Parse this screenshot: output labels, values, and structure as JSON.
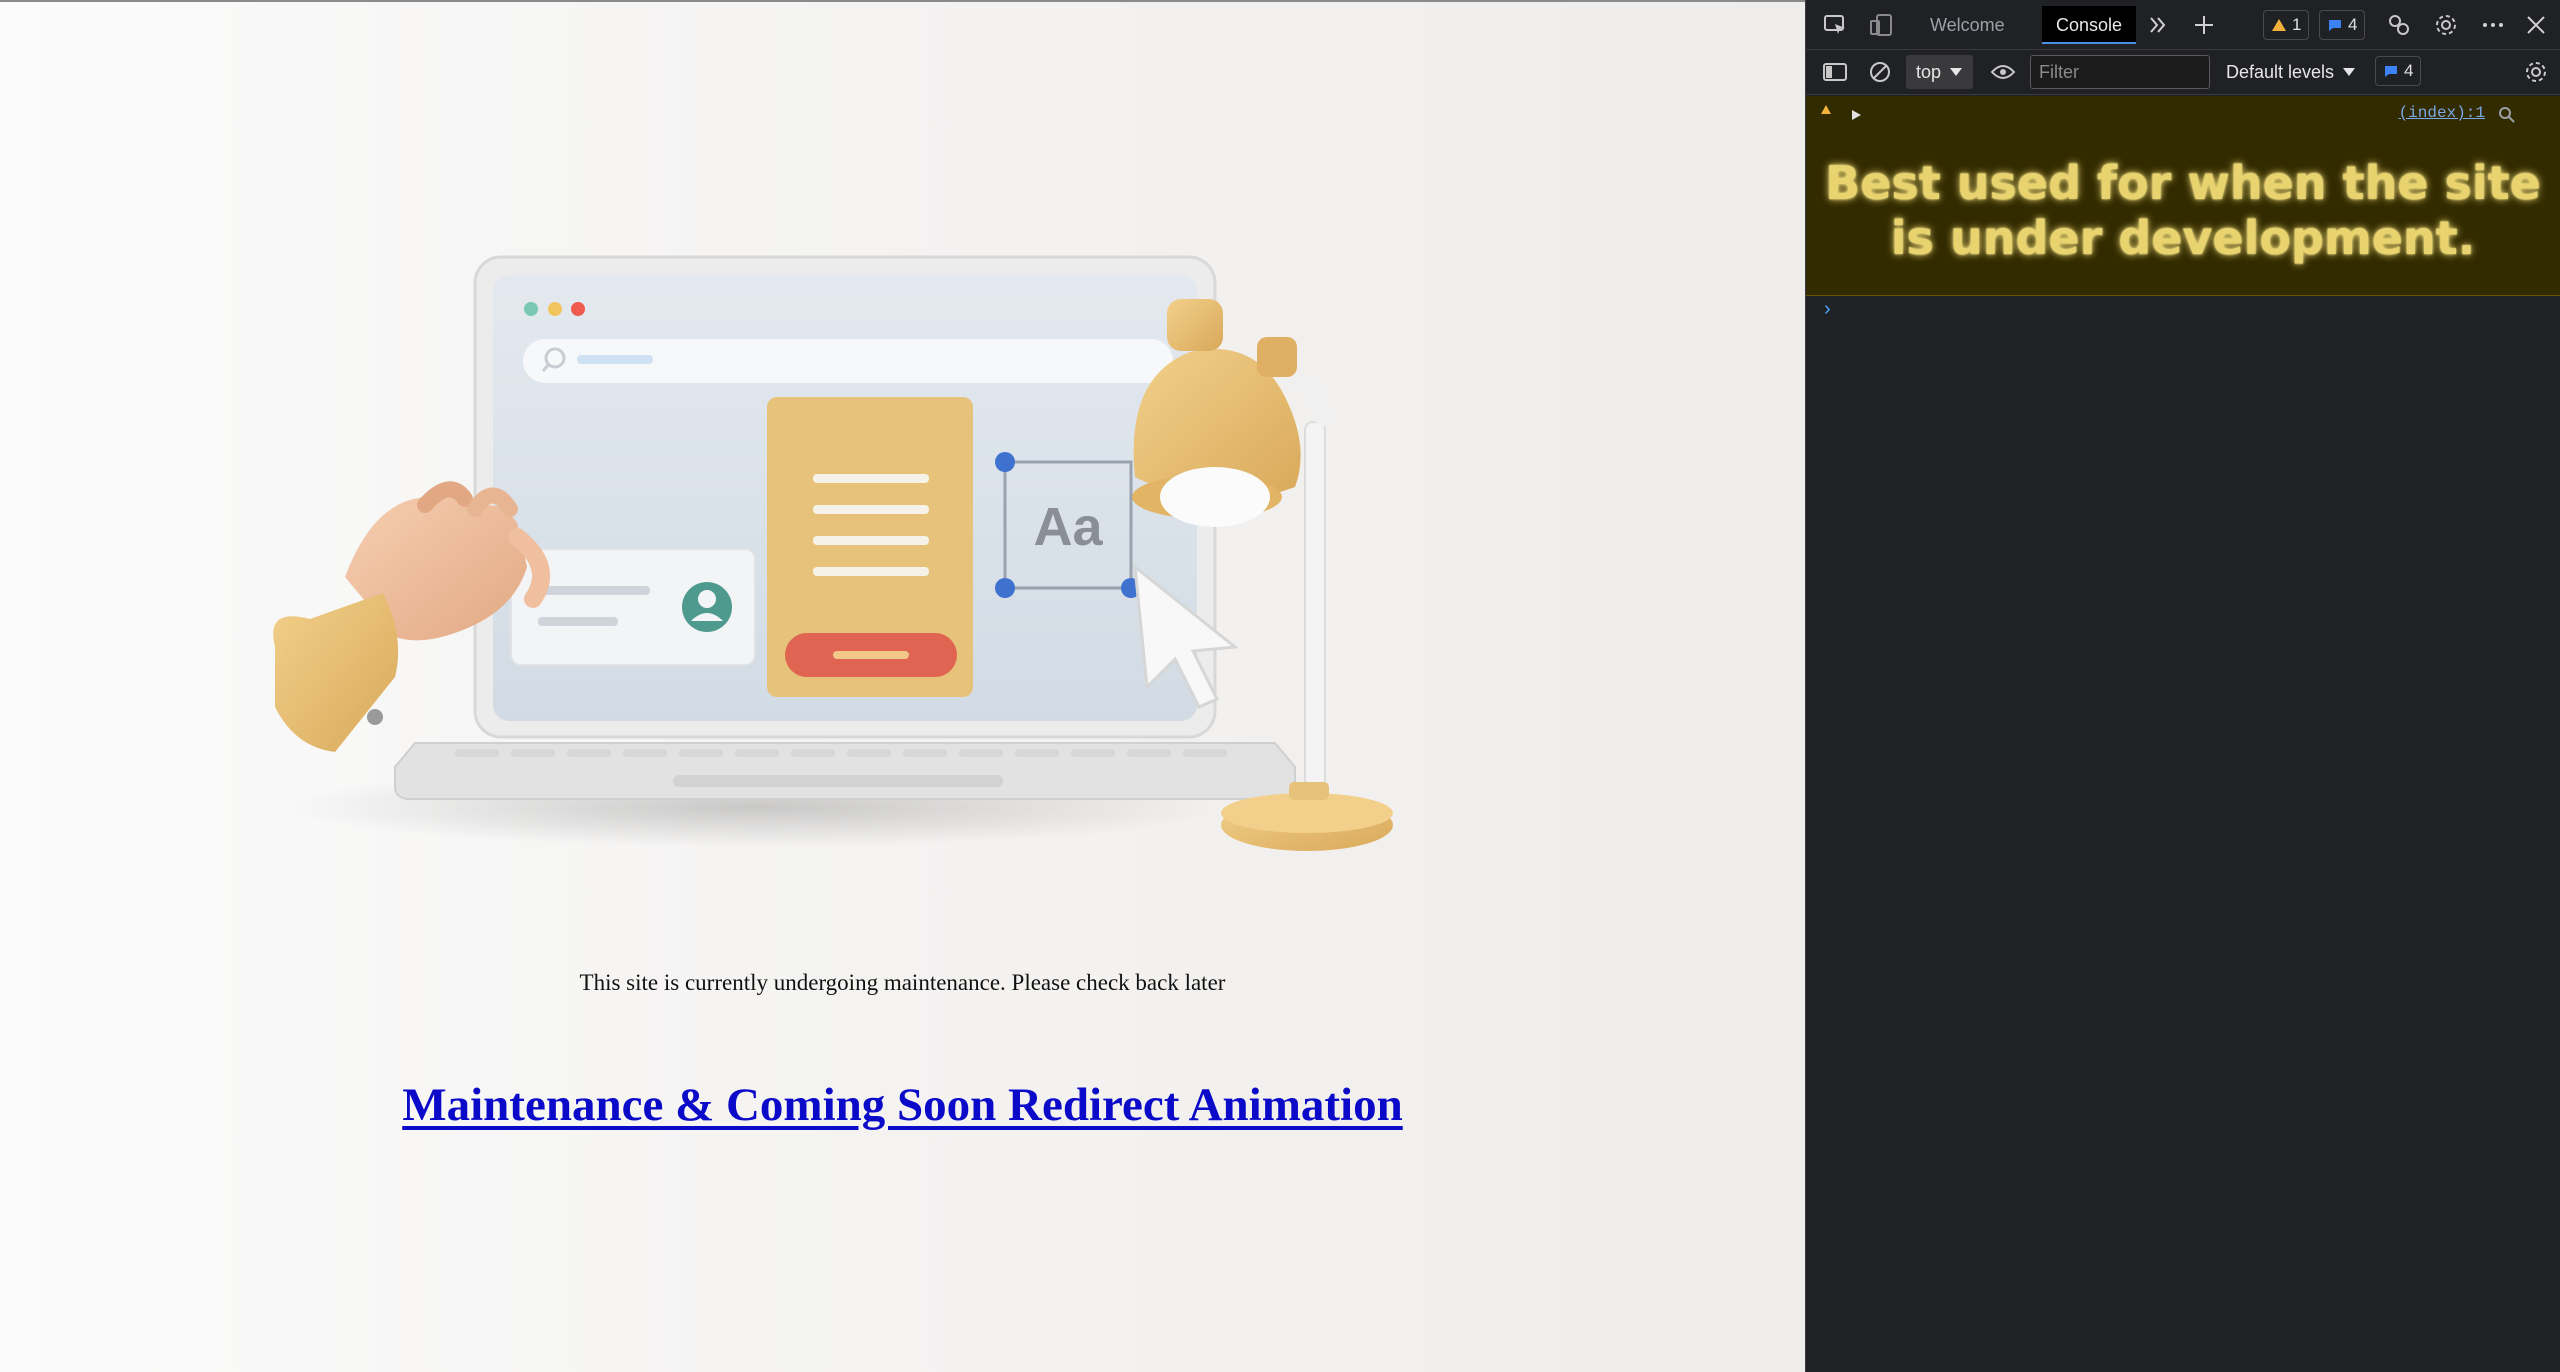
{
  "page": {
    "maintenance_text": "This site is currently undergoing maintenance. Please check back later",
    "title_link": "Maintenance & Coming Soon Redirect Animation",
    "illustration": {
      "letters_label": "Aa"
    }
  },
  "devtools": {
    "tabs": {
      "welcome": "Welcome",
      "console": "Console"
    },
    "badges": {
      "warnings": "1",
      "messages": "4"
    },
    "toolbar": {
      "context": "top",
      "filter_placeholder": "Filter",
      "levels": "Default levels",
      "issues_count": "4"
    },
    "console": {
      "source_link": "(index):1",
      "warning_text_line1": "Best used for when the site",
      "warning_text_line2": "is under development."
    },
    "colors": {
      "panel_bg": "#202124",
      "warning_bg": "#332b00",
      "warning_text": "#e8d36e",
      "accent_blue": "#4a90e2"
    }
  }
}
